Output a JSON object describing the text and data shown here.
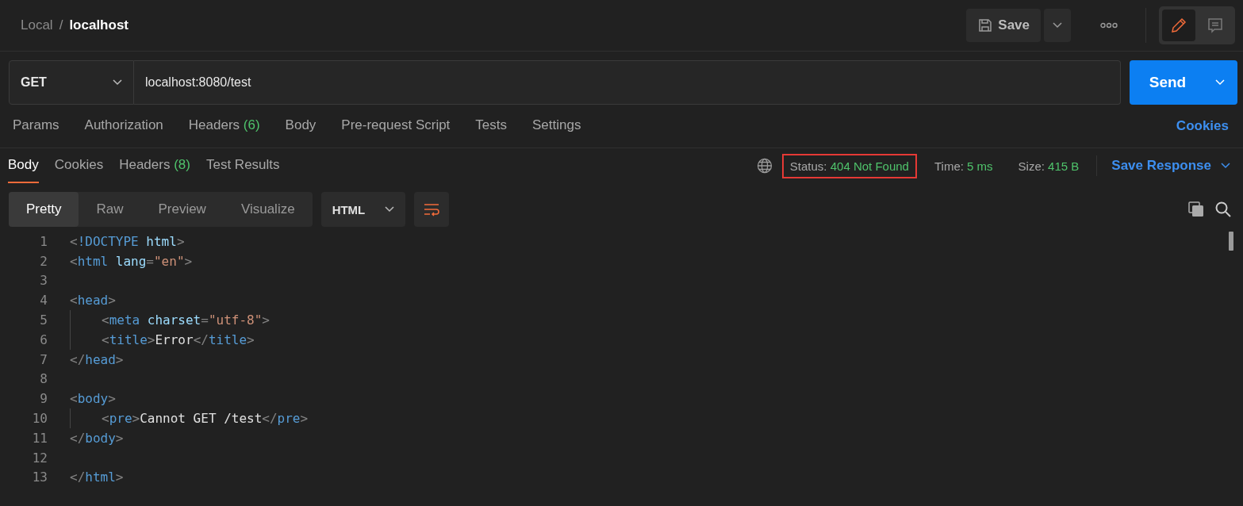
{
  "breadcrumb": {
    "parent": "Local",
    "separator": "/",
    "current": "localhost"
  },
  "toolbar": {
    "save_label": "Save",
    "edit_mode": true
  },
  "request": {
    "method": "GET",
    "url": "localhost:8080/test",
    "send_label": "Send"
  },
  "request_tabs": [
    {
      "label": "Params",
      "selected": false
    },
    {
      "label": "Authorization",
      "selected": false
    },
    {
      "label": "Headers",
      "count": "(6)",
      "selected": false
    },
    {
      "label": "Body",
      "selected": false
    },
    {
      "label": "Pre-request Script",
      "selected": false
    },
    {
      "label": "Tests",
      "selected": false
    },
    {
      "label": "Settings",
      "selected": false
    }
  ],
  "cookies_link": "Cookies",
  "response_tabs": [
    {
      "label": "Body",
      "selected": true
    },
    {
      "label": "Cookies",
      "selected": false
    },
    {
      "label": "Headers",
      "count": "(8)",
      "selected": false
    },
    {
      "label": "Test Results",
      "selected": false
    }
  ],
  "response_meta": [
    {
      "label": "Status:",
      "value": "404 Not Found",
      "highlighted": true
    },
    {
      "label": "Time:",
      "value": "5 ms",
      "highlighted": false
    },
    {
      "label": "Size:",
      "value": "415 B",
      "highlighted": false
    }
  ],
  "save_response": "Save Response",
  "view_modes": [
    {
      "label": "Pretty",
      "selected": true
    },
    {
      "label": "Raw",
      "selected": false
    },
    {
      "label": "Preview",
      "selected": false
    },
    {
      "label": "Visualize",
      "selected": false
    }
  ],
  "format": "HTML",
  "code_lines": [
    {
      "number": "1",
      "guide": false,
      "tokens": [
        {
          "kind": "punct",
          "text": "<"
        },
        {
          "kind": "doctype",
          "text": "!DOCTYPE"
        },
        {
          "kind": "attr",
          "text": " html"
        },
        {
          "kind": "punct",
          "text": ">"
        }
      ]
    },
    {
      "number": "2",
      "guide": false,
      "tokens": [
        {
          "kind": "punct",
          "text": "<"
        },
        {
          "kind": "tag",
          "text": "html"
        },
        {
          "kind": "attr",
          "text": " lang"
        },
        {
          "kind": "punct",
          "text": "="
        },
        {
          "kind": "str",
          "text": "\"en\""
        },
        {
          "kind": "punct",
          "text": ">"
        }
      ]
    },
    {
      "number": "3",
      "guide": false
    },
    {
      "number": "4",
      "guide": false,
      "tokens": [
        {
          "kind": "punct",
          "text": "<"
        },
        {
          "kind": "tag",
          "text": "head"
        },
        {
          "kind": "punct",
          "text": ">"
        }
      ]
    },
    {
      "number": "5",
      "guide": true,
      "tokens": [
        {
          "kind": "punct",
          "text": "<"
        },
        {
          "kind": "tag",
          "text": "meta"
        },
        {
          "kind": "attr",
          "text": " charset"
        },
        {
          "kind": "punct",
          "text": "="
        },
        {
          "kind": "str",
          "text": "\"utf-8\""
        },
        {
          "kind": "punct",
          "text": ">"
        }
      ]
    },
    {
      "number": "6",
      "guide": true,
      "tokens": [
        {
          "kind": "punct",
          "text": "<"
        },
        {
          "kind": "tag",
          "text": "title"
        },
        {
          "kind": "punct",
          "text": ">"
        },
        {
          "kind": "text",
          "text": "Error"
        },
        {
          "kind": "punct",
          "text": "</"
        },
        {
          "kind": "tag",
          "text": "title"
        },
        {
          "kind": "punct",
          "text": ">"
        }
      ]
    },
    {
      "number": "7",
      "guide": false,
      "tokens": [
        {
          "kind": "punct",
          "text": "</"
        },
        {
          "kind": "tag",
          "text": "head"
        },
        {
          "kind": "punct",
          "text": ">"
        }
      ]
    },
    {
      "number": "8",
      "guide": false
    },
    {
      "number": "9",
      "guide": false,
      "tokens": [
        {
          "kind": "punct",
          "text": "<"
        },
        {
          "kind": "tag",
          "text": "body"
        },
        {
          "kind": "punct",
          "text": ">"
        }
      ]
    },
    {
      "number": "10",
      "guide": true,
      "tokens": [
        {
          "kind": "punct",
          "text": "<"
        },
        {
          "kind": "tag",
          "text": "pre"
        },
        {
          "kind": "punct",
          "text": ">"
        },
        {
          "kind": "text",
          "text": "Cannot GET /test"
        },
        {
          "kind": "punct",
          "text": "</"
        },
        {
          "kind": "tag",
          "text": "pre"
        },
        {
          "kind": "punct",
          "text": ">"
        }
      ]
    },
    {
      "number": "11",
      "guide": false,
      "tokens": [
        {
          "kind": "punct",
          "text": "</"
        },
        {
          "kind": "tag",
          "text": "body"
        },
        {
          "kind": "punct",
          "text": ">"
        }
      ]
    },
    {
      "number": "12",
      "guide": false
    },
    {
      "number": "13",
      "guide": false,
      "tokens": [
        {
          "kind": "punct",
          "text": "</"
        },
        {
          "kind": "tag",
          "text": "html"
        },
        {
          "kind": "punct",
          "text": ">"
        }
      ]
    }
  ]
}
